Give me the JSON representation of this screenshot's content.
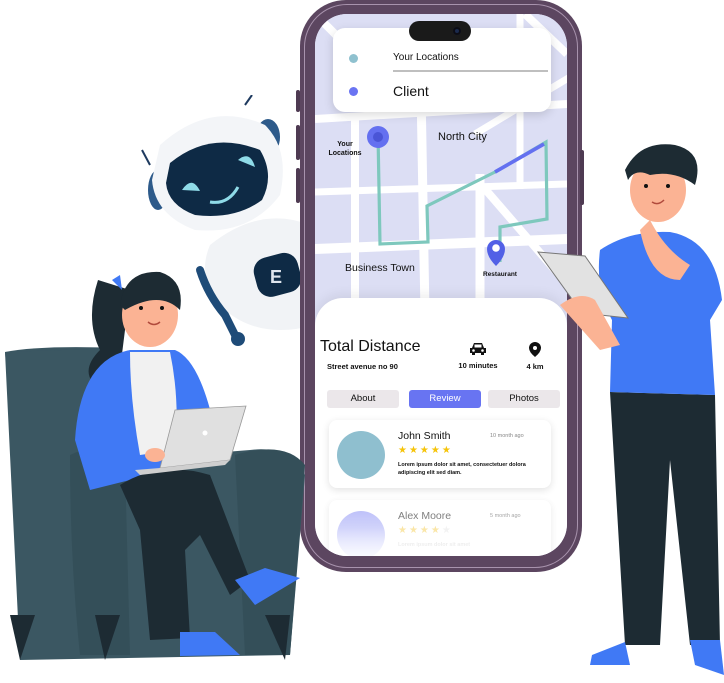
{
  "phone": {
    "location_card": {
      "items": [
        {
          "label": "Your Locations",
          "dot_color": "#8fc1cf"
        },
        {
          "label": "Client",
          "dot_color": "#6a74f2"
        }
      ]
    },
    "map": {
      "labels": {
        "your_locations_line1": "Your",
        "your_locations_line2": "Locations",
        "north_city": "North City",
        "business_town": "Business Town",
        "restaurant": "Restaurant"
      },
      "route_color": "#7ec8bd",
      "route_highlight_color": "#6470f0",
      "pin_color": "#5260e6"
    },
    "trip": {
      "title": "Total Distance",
      "address": "Street avenue no 90",
      "duration_icon": "car-icon",
      "duration": "10 minutes",
      "distance_icon": "map-pin-icon",
      "distance": "4 km"
    },
    "tabs": [
      {
        "label": "About",
        "active": false
      },
      {
        "label": "Review",
        "active": true
      },
      {
        "label": "Photos",
        "active": false
      }
    ],
    "reviews": [
      {
        "name": "John Smith",
        "time": "10 month ago",
        "rating": 5,
        "max_rating": 5,
        "stars": "★★★★★",
        "text": "Lorem ipsum dolor sit amet, consectetuer dolora adipiscing elit sed diam.",
        "avatar_color": "#8fbfcf"
      },
      {
        "name": "Alex Moore",
        "time": "5 month ago",
        "rating": 4,
        "max_rating": 5,
        "stars": "★★★★",
        "empty_stars": "★",
        "text": "Lorem ipsum dolor sit amet",
        "avatar_color": "#a9adf7"
      }
    ]
  },
  "illustration": {
    "robot_badge": "E",
    "colors": {
      "phone_frame": "#5c4660",
      "accent_blue": "#4079f5",
      "chair": "#3b5762",
      "pants": "#1d2b33",
      "skin": "#fbb394"
    }
  }
}
